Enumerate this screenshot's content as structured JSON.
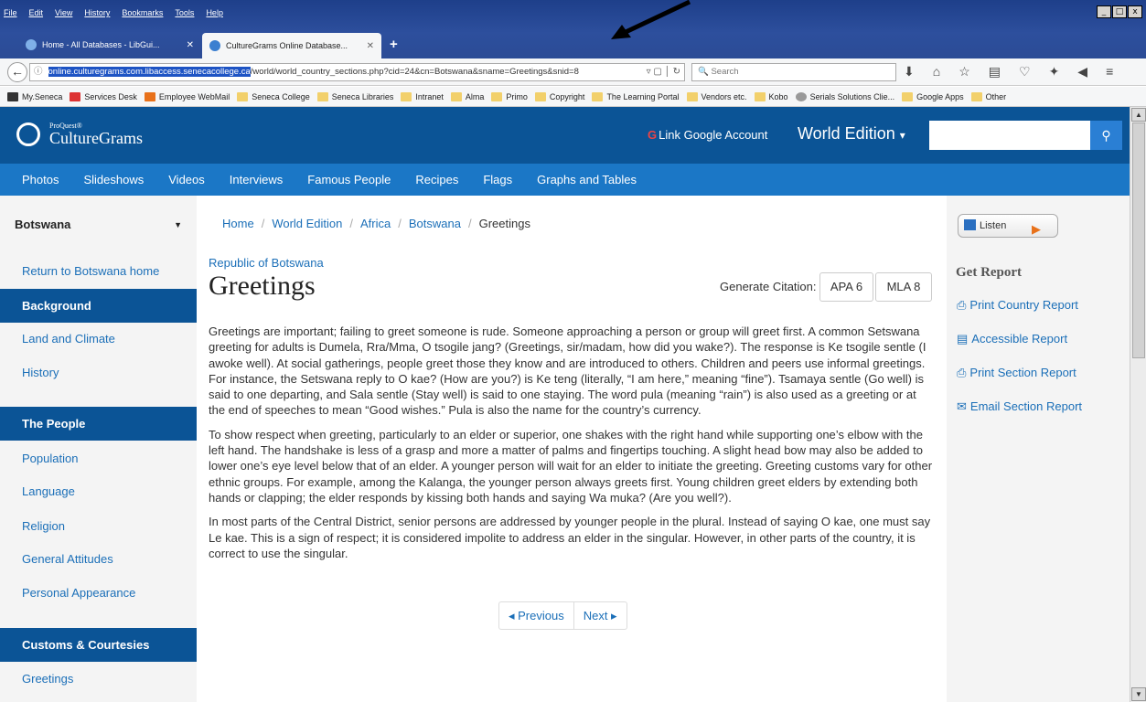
{
  "browser": {
    "menu": [
      "File",
      "Edit",
      "View",
      "History",
      "Bookmarks",
      "Tools",
      "Help"
    ],
    "tabs": [
      {
        "label": "Home - All Databases - LibGui..."
      },
      {
        "label": "CultureGrams Online Database..."
      }
    ],
    "url": {
      "highlighted": "online.culturegrams.com.libaccess.senecacollege.ca",
      "rest": "/world/world_country_sections.php?cid=24&cn=Botswana&sname=Greetings&snid=8"
    },
    "search_placeholder": "Search",
    "bookmarks": [
      "My.Seneca",
      "Services Desk",
      "Employee WebMail",
      "Seneca College",
      "Seneca Libraries",
      "Intranet",
      "Alma",
      "Primo",
      "Copyright",
      "The Learning Portal",
      "Vendors etc.",
      "Kobo",
      "Serials Solutions Clie...",
      "Google Apps",
      "Other"
    ]
  },
  "site": {
    "logo_small": "ProQuest®",
    "logo_name": "CultureGrams",
    "google_link": "Link Google Account",
    "edition": "World Edition",
    "nav": [
      "Photos",
      "Slideshows",
      "Videos",
      "Interviews",
      "Famous People",
      "Recipes",
      "Flags",
      "Graphs and Tables"
    ]
  },
  "sidebar": {
    "country": "Botswana",
    "return_link": "Return to Botswana home",
    "background_head": "Background",
    "background_items": [
      "Land and Climate",
      "History"
    ],
    "people_head": "The People",
    "people_items": [
      "Population",
      "Language",
      "Religion",
      "General Attitudes",
      "Personal Appearance"
    ],
    "customs_head": "Customs & Courtesies",
    "customs_items": [
      "Greetings"
    ]
  },
  "main": {
    "breadcrumb": [
      "Home",
      "World Edition",
      "Africa",
      "Botswana",
      "Greetings"
    ],
    "country_official": "Republic of Botswana",
    "title": "Greetings",
    "citation_label": "Generate Citation:",
    "citation_apa": "APA 6",
    "citation_mla": "MLA 8",
    "paragraphs": [
      "Greetings are important; failing to greet someone is rude. Someone approaching a person or group will greet first. A common Setswana greeting for adults is Dumela, Rra/Mma, O tsogile jang? (Greetings, sir/madam, how did you wake?). The response is Ke tsogile sentle (I awoke well). At social gatherings, people greet those they know and are introduced to others. Children and peers use informal greetings. For instance, the Setswana reply to O kae? (How are you?) is Ke teng (literally, “I am here,” meaning “fine”). Tsamaya sentle (Go well) is said to one departing, and Sala sentle (Stay well) is said to one staying. The word pula (meaning “rain”) is also used as a greeting or at the end of speeches to mean “Good wishes.” Pula is also the name for the country’s currency.",
      "To show respect when greeting, particularly to an elder or superior, one shakes with the right hand while supporting one’s elbow with the left hand. The handshake is less of a grasp and more a matter of palms and fingertips touching. A slight head bow may also be added to lower one’s eye level below that of an elder. A younger person will wait for an elder to initiate the greeting. Greeting customs vary for other ethnic groups. For example, among the Kalanga, the younger person always greets first. Young children greet elders by extending both hands or clapping; the elder responds by kissing both hands and saying Wa muka? (Are you well?).",
      "In most parts of the Central District, senior persons are addressed by younger people in the plural. Instead of saying O kae, one must say Le kae. This is a sign of respect; it is considered impolite to address an elder in the singular. However, in other parts of the country, it is correct to use the singular."
    ],
    "prev": "◂ Previous",
    "next": "Next ▸"
  },
  "right": {
    "listen": "Listen",
    "get_report": "Get Report",
    "reports": [
      "Print Country Report",
      "Accessible Report",
      "Print Section Report",
      "Email Section Report"
    ]
  },
  "colors": {
    "header": "#0b5496",
    "nav": "#1b77c6",
    "link": "#1b6fb8"
  }
}
